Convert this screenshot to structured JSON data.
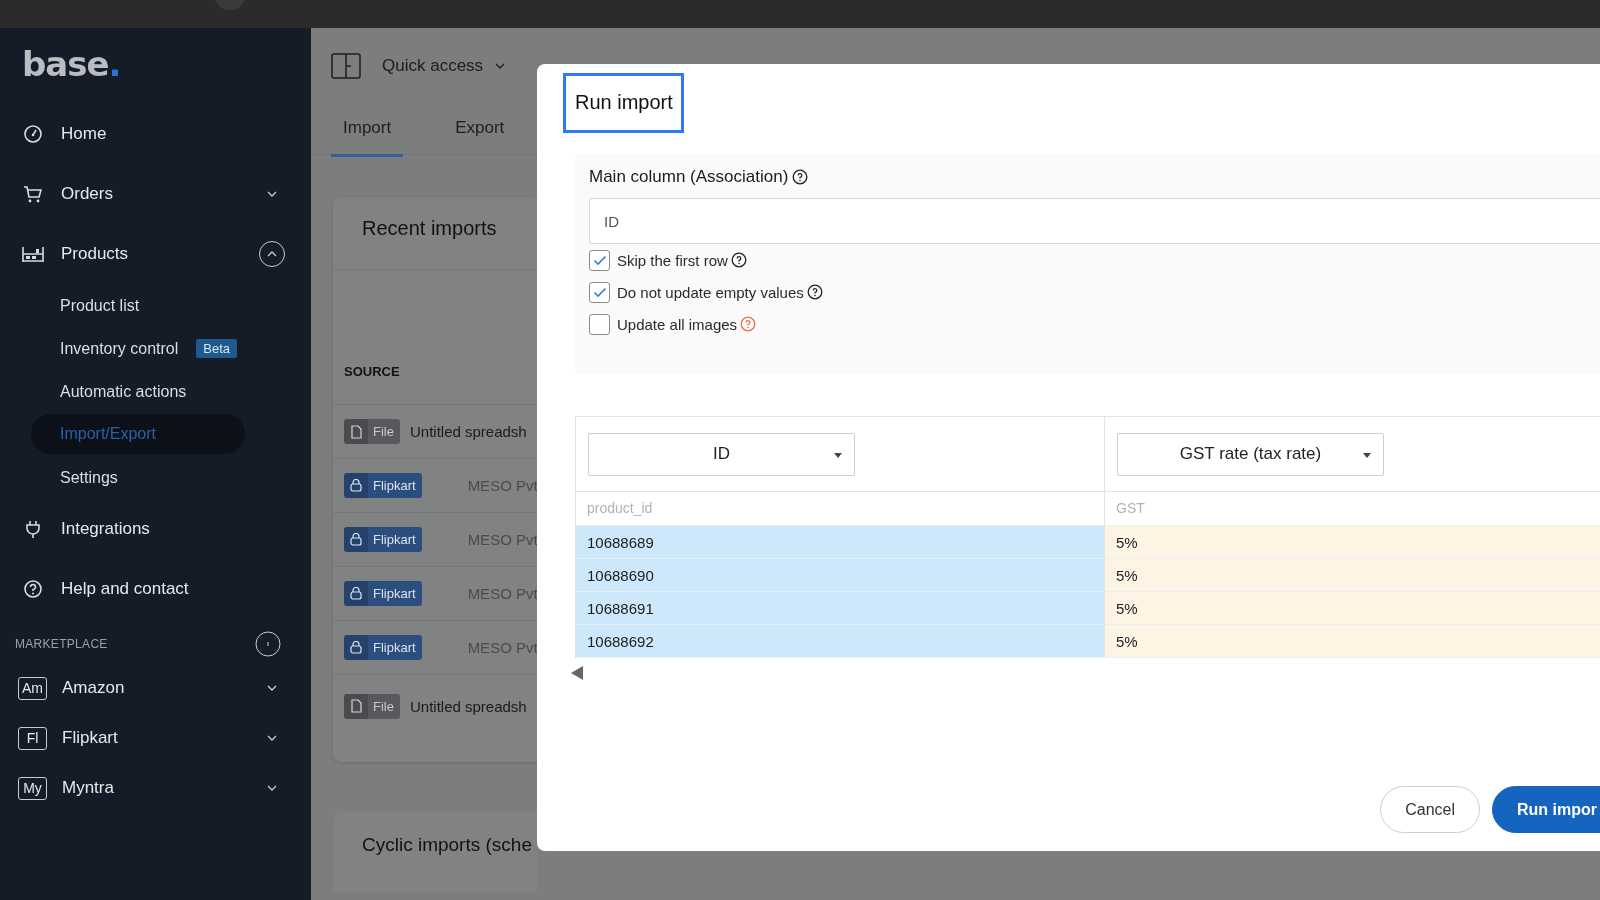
{
  "logo": {
    "text": "base",
    "dot": "."
  },
  "sidebar": {
    "items": [
      {
        "label": "Home"
      },
      {
        "label": "Orders",
        "expanded": false
      },
      {
        "label": "Products",
        "expanded": true,
        "children": [
          {
            "label": "Product list",
            "selected": false
          },
          {
            "label": "Inventory control",
            "badge": "Beta",
            "selected": false
          },
          {
            "label": "Automatic actions",
            "selected": false
          },
          {
            "label": "Import/Export",
            "selected": true
          },
          {
            "label": "Settings",
            "selected": false
          }
        ]
      },
      {
        "label": "Integrations"
      },
      {
        "label": "Help and contact"
      }
    ],
    "section_title": "MARKETPLACE",
    "marketplaces": [
      {
        "abbr": "Am",
        "label": "Amazon",
        "expanded": false
      },
      {
        "abbr": "Fl",
        "label": "Flipkart",
        "expanded": false
      },
      {
        "abbr": "My",
        "label": "Myntra",
        "expanded": false
      }
    ]
  },
  "header": {
    "quick_access": "Quick access"
  },
  "tabs": [
    {
      "label": "Import",
      "selected": true
    },
    {
      "label": "Export",
      "selected": false
    }
  ],
  "recent_imports": {
    "title": "Recent imports",
    "column": "SOURCE",
    "rows": [
      {
        "kind": "file",
        "badge": "File",
        "name": "Untitled spreadsh"
      },
      {
        "kind": "shop",
        "badge": "Flipkart",
        "name": "MESO Pvt"
      },
      {
        "kind": "shop",
        "badge": "Flipkart",
        "name": "MESO Pvt"
      },
      {
        "kind": "shop",
        "badge": "Flipkart",
        "name": "MESO Pvt"
      },
      {
        "kind": "shop",
        "badge": "Flipkart",
        "name": "MESO Pvt"
      },
      {
        "kind": "file",
        "badge": "File",
        "name": "Untitled spreadsh"
      }
    ]
  },
  "cyclic_imports": {
    "title": "Cyclic imports (sche"
  },
  "dialog": {
    "title": "Run import",
    "main_column": {
      "label": "Main column (Association)",
      "value": "ID"
    },
    "options": [
      {
        "label": "Skip the first row",
        "checked": true,
        "warning": false
      },
      {
        "label": "Do not update empty values",
        "checked": true,
        "warning": false
      },
      {
        "label": "Update all images",
        "checked": false,
        "warning": true
      }
    ],
    "table": {
      "columns": [
        {
          "mapping": "ID",
          "source": "product_id",
          "color": "#cde8fb",
          "values": [
            "10688689",
            "10688690",
            "10688691",
            "10688692"
          ]
        },
        {
          "mapping": "GST rate (tax rate)",
          "source": "GST",
          "color": "#fdf4e4",
          "values": [
            "5%",
            "5%",
            "5%",
            "5%"
          ]
        }
      ]
    },
    "buttons": [
      {
        "label": "Cancel",
        "kind": "secondary"
      },
      {
        "label": "Run impor",
        "kind": "primary"
      }
    ]
  }
}
